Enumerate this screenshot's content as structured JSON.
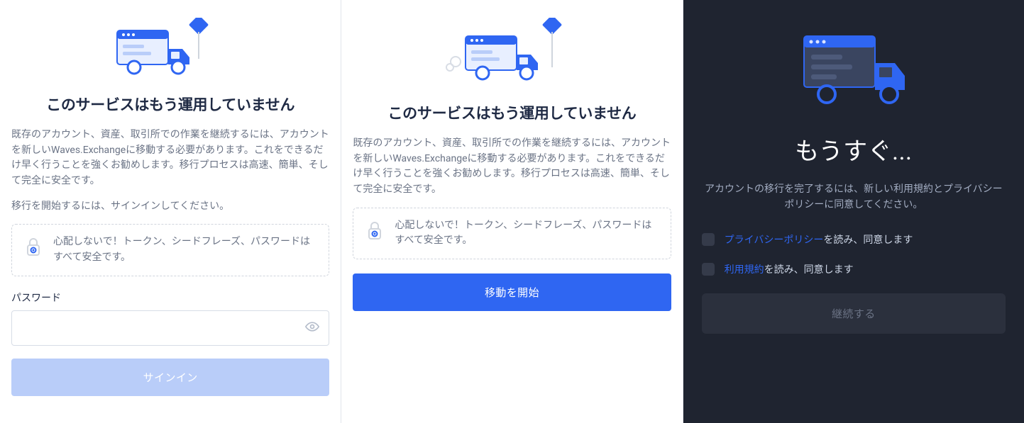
{
  "panel1": {
    "title": "このサービスはもう運用していません",
    "body1": "既存のアカウント、資産、取引所での作業を継続するには、アカウントを新しいWaves.Exchangeに移動する必要があります。これをできるだけ早く行うことを強くお勧めします。移行プロセスは高速、簡単、そして完全に安全です。",
    "body2": "移行を開始するには、サインインしてください。",
    "notice": "心配しないで！トークン、シードフレーズ、パスワードはすべて安全です。",
    "password_label": "パスワード",
    "signin_button": "サインイン"
  },
  "panel2": {
    "title": "このサービスはもう運用していません",
    "body1": "既存のアカウント、資産、取引所での作業を継続するには、アカウントを新しいWaves.Exchangeに移動する必要があります。これをできるだけ早く行うことを強くお勧めします。移行プロセスは高速、簡単、そして完全に安全です。",
    "notice": "心配しないで！トークン、シードフレーズ、パスワードはすべて安全です。",
    "start_button": "移動を開始"
  },
  "panel3": {
    "title": "もうすぐ...",
    "subtitle": "アカウントの移行を完了するには、新しい利用規約とプライバシーポリシーに同意してください。",
    "check1_link": "プライバシーポリシー",
    "check1_rest": "を読み、同意します",
    "check2_link": "利用規約",
    "check2_rest": "を読み、同意します",
    "continue_button": "継続する"
  }
}
